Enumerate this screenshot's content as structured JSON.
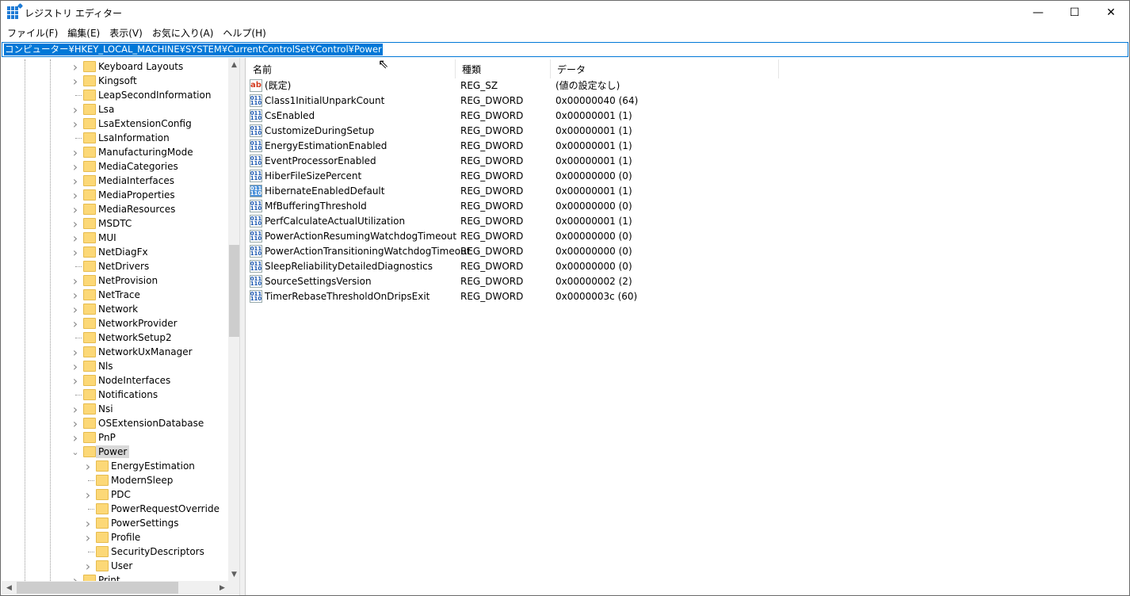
{
  "window": {
    "title": "レジストリ エディター",
    "minimize": "—",
    "maximize": "☐",
    "close": "✕"
  },
  "menu": [
    "ファイル(F)",
    "編集(E)",
    "表示(V)",
    "お気に入り(A)",
    "ヘルプ(H)"
  ],
  "address": "コンピューター¥HKEY_LOCAL_MACHINE¥SYSTEM¥CurrentControlSet¥Control¥Power",
  "tree": [
    {
      "label": "Keyboard Layouts",
      "level": 0,
      "expander": "collapsed"
    },
    {
      "label": "Kingsoft",
      "level": 0,
      "expander": "collapsed"
    },
    {
      "label": "LeapSecondInformation",
      "level": 0,
      "expander": "none"
    },
    {
      "label": "Lsa",
      "level": 0,
      "expander": "collapsed"
    },
    {
      "label": "LsaExtensionConfig",
      "level": 0,
      "expander": "collapsed"
    },
    {
      "label": "LsaInformation",
      "level": 0,
      "expander": "none"
    },
    {
      "label": "ManufacturingMode",
      "level": 0,
      "expander": "collapsed"
    },
    {
      "label": "MediaCategories",
      "level": 0,
      "expander": "collapsed"
    },
    {
      "label": "MediaInterfaces",
      "level": 0,
      "expander": "collapsed"
    },
    {
      "label": "MediaProperties",
      "level": 0,
      "expander": "collapsed"
    },
    {
      "label": "MediaResources",
      "level": 0,
      "expander": "collapsed"
    },
    {
      "label": "MSDTC",
      "level": 0,
      "expander": "collapsed"
    },
    {
      "label": "MUI",
      "level": 0,
      "expander": "collapsed"
    },
    {
      "label": "NetDiagFx",
      "level": 0,
      "expander": "collapsed"
    },
    {
      "label": "NetDrivers",
      "level": 0,
      "expander": "none"
    },
    {
      "label": "NetProvision",
      "level": 0,
      "expander": "collapsed"
    },
    {
      "label": "NetTrace",
      "level": 0,
      "expander": "collapsed"
    },
    {
      "label": "Network",
      "level": 0,
      "expander": "collapsed"
    },
    {
      "label": "NetworkProvider",
      "level": 0,
      "expander": "collapsed"
    },
    {
      "label": "NetworkSetup2",
      "level": 0,
      "expander": "none"
    },
    {
      "label": "NetworkUxManager",
      "level": 0,
      "expander": "collapsed"
    },
    {
      "label": "Nls",
      "level": 0,
      "expander": "collapsed"
    },
    {
      "label": "NodeInterfaces",
      "level": 0,
      "expander": "collapsed"
    },
    {
      "label": "Notifications",
      "level": 0,
      "expander": "none"
    },
    {
      "label": "Nsi",
      "level": 0,
      "expander": "collapsed"
    },
    {
      "label": "OSExtensionDatabase",
      "level": 0,
      "expander": "collapsed"
    },
    {
      "label": "PnP",
      "level": 0,
      "expander": "collapsed"
    },
    {
      "label": "Power",
      "level": 0,
      "expander": "expanded",
      "selected": true
    },
    {
      "label": "EnergyEstimation",
      "level": 1,
      "expander": "collapsed"
    },
    {
      "label": "ModernSleep",
      "level": 1,
      "expander": "none"
    },
    {
      "label": "PDC",
      "level": 1,
      "expander": "collapsed"
    },
    {
      "label": "PowerRequestOverride",
      "level": 1,
      "expander": "none"
    },
    {
      "label": "PowerSettings",
      "level": 1,
      "expander": "collapsed"
    },
    {
      "label": "Profile",
      "level": 1,
      "expander": "collapsed"
    },
    {
      "label": "SecurityDescriptors",
      "level": 1,
      "expander": "none"
    },
    {
      "label": "User",
      "level": 1,
      "expander": "collapsed"
    },
    {
      "label": "Print",
      "level": 0,
      "expander": "collapsed"
    }
  ],
  "columns": {
    "name": "名前",
    "type": "種類",
    "data": "データ"
  },
  "values": [
    {
      "name": "(既定)",
      "type": "REG_SZ",
      "data": "(値の設定なし)",
      "icon": "string-value-icon"
    },
    {
      "name": "Class1InitialUnparkCount",
      "type": "REG_DWORD",
      "data": "0x00000040 (64)",
      "icon": "binary-value-icon"
    },
    {
      "name": "CsEnabled",
      "type": "REG_DWORD",
      "data": "0x00000001 (1)",
      "icon": "binary-value-icon"
    },
    {
      "name": "CustomizeDuringSetup",
      "type": "REG_DWORD",
      "data": "0x00000001 (1)",
      "icon": "binary-value-icon"
    },
    {
      "name": "EnergyEstimationEnabled",
      "type": "REG_DWORD",
      "data": "0x00000001 (1)",
      "icon": "binary-value-icon"
    },
    {
      "name": "EventProcessorEnabled",
      "type": "REG_DWORD",
      "data": "0x00000001 (1)",
      "icon": "binary-value-icon"
    },
    {
      "name": "HiberFileSizePercent",
      "type": "REG_DWORD",
      "data": "0x00000000 (0)",
      "icon": "binary-value-icon"
    },
    {
      "name": "HibernateEnabledDefault",
      "type": "REG_DWORD",
      "data": "0x00000001 (1)",
      "icon": "binary-value-icon",
      "highlighted": true
    },
    {
      "name": "MfBufferingThreshold",
      "type": "REG_DWORD",
      "data": "0x00000000 (0)",
      "icon": "binary-value-icon"
    },
    {
      "name": "PerfCalculateActualUtilization",
      "type": "REG_DWORD",
      "data": "0x00000001 (1)",
      "icon": "binary-value-icon"
    },
    {
      "name": "PowerActionResumingWatchdogTimeout",
      "type": "REG_DWORD",
      "data": "0x00000000 (0)",
      "icon": "binary-value-icon"
    },
    {
      "name": "PowerActionTransitioningWatchdogTimeout",
      "type": "REG_DWORD",
      "data": "0x00000000 (0)",
      "icon": "binary-value-icon"
    },
    {
      "name": "SleepReliabilityDetailedDiagnostics",
      "type": "REG_DWORD",
      "data": "0x00000000 (0)",
      "icon": "binary-value-icon"
    },
    {
      "name": "SourceSettingsVersion",
      "type": "REG_DWORD",
      "data": "0x00000002 (2)",
      "icon": "binary-value-icon"
    },
    {
      "name": "TimerRebaseThresholdOnDripsExit",
      "type": "REG_DWORD",
      "data": "0x0000003c (60)",
      "icon": "binary-value-icon"
    }
  ],
  "colors": {
    "accent": "#0078d7",
    "folder": "#fcd877",
    "selection": "#d9d9d9"
  }
}
